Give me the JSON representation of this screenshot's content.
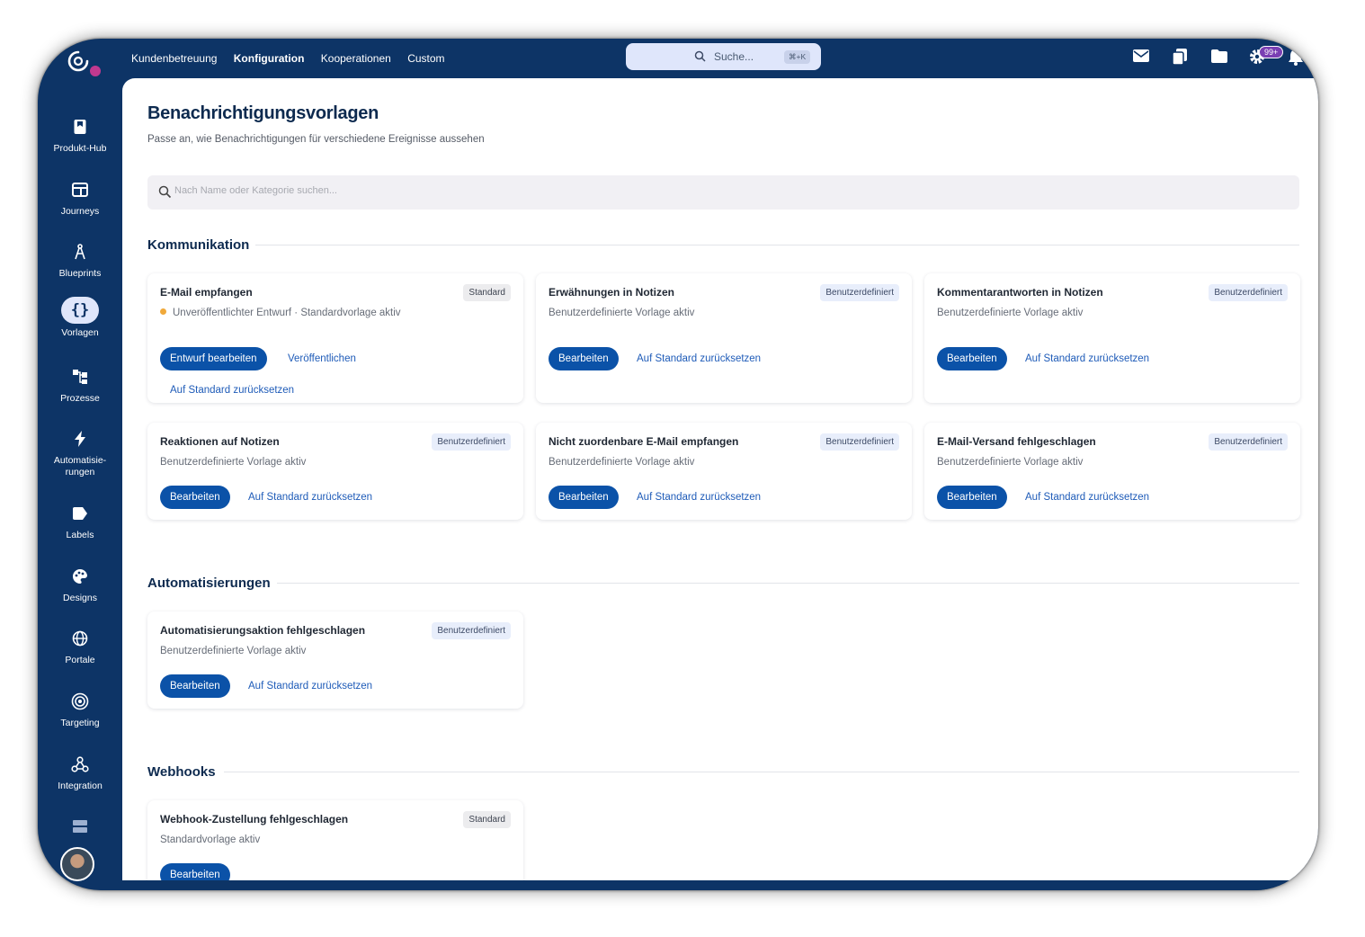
{
  "sidebar": {
    "items": [
      {
        "label": "Produkt-Hub",
        "icon": "bookmark-icon"
      },
      {
        "label": "Journeys",
        "icon": "layout-icon"
      },
      {
        "label": "Blueprints",
        "icon": "compass-icon"
      },
      {
        "label": "Vorlagen",
        "icon": "braces-icon",
        "active": true
      },
      {
        "label": "Prozesse",
        "icon": "workflow-icon"
      },
      {
        "label": "Automatisie-\nrungen",
        "icon": "bolt-icon"
      },
      {
        "label": "Labels",
        "icon": "tag-icon"
      },
      {
        "label": "Designs",
        "icon": "palette-icon"
      },
      {
        "label": "Portale",
        "icon": "globe-icon"
      },
      {
        "label": "Targeting",
        "icon": "target-icon"
      },
      {
        "label": "Integration",
        "icon": "webhook-icon"
      }
    ]
  },
  "topbar": {
    "nav": [
      "Kundenbetreuung",
      "Konfiguration",
      "Kooperationen",
      "Custom"
    ],
    "active_nav": "Konfiguration",
    "search_label": "Suche...",
    "search_shortcut": "⌘+K",
    "notification_count": "99+"
  },
  "page": {
    "title": "Benachrichtigungsvorlagen",
    "subtitle": "Passe an, wie Benachrichtigungen für verschiedene Ereignisse aussehen",
    "filter_placeholder": "Nach Name oder Kategorie suchen..."
  },
  "sections": {
    "kommunikation": "Kommunikation",
    "automatisierungen": "Automatisierungen",
    "webhooks": "Webhooks"
  },
  "cards": {
    "email_received": {
      "title": "E-Mail empfangen",
      "status": "Unveröffentlichter Entwurf · Standardvorlage aktiv",
      "tag": "Standard",
      "primary": "Entwurf bearbeiten",
      "link1": "Veröffentlichen",
      "link2": "Auf Standard zurücksetzen"
    },
    "mentions": {
      "title": "Erwähnungen in Notizen",
      "status": "Benutzerdefinierte Vorlage aktiv",
      "tag": "Benutzerdefiniert",
      "primary": "Bearbeiten",
      "link1": "Auf Standard zurücksetzen"
    },
    "comment_replies": {
      "title": "Kommentarantworten in Notizen",
      "status": "Benutzerdefinierte Vorlage aktiv",
      "tag": "Benutzerdefiniert",
      "primary": "Bearbeiten",
      "link1": "Auf Standard zurücksetzen"
    },
    "reactions": {
      "title": "Reaktionen auf Notizen",
      "status": "Benutzerdefinierte Vorlage aktiv",
      "tag": "Benutzerdefiniert",
      "primary": "Bearbeiten",
      "link1": "Auf Standard zurücksetzen"
    },
    "unassignable_email": {
      "title": "Nicht zuordenbare E-Mail empfangen",
      "status": "Benutzerdefinierte Vorlage aktiv",
      "tag": "Benutzerdefiniert",
      "primary": "Bearbeiten",
      "link1": "Auf Standard zurücksetzen"
    },
    "email_failed": {
      "title": "E-Mail-Versand fehlgeschlagen",
      "status": "Benutzerdefinierte Vorlage aktiv",
      "tag": "Benutzerdefiniert",
      "primary": "Bearbeiten",
      "link1": "Auf Standard zurücksetzen"
    },
    "automation_failed": {
      "title": "Automatisierungsaktion fehlgeschlagen",
      "status": "Benutzerdefinierte Vorlage aktiv",
      "tag": "Benutzerdefiniert",
      "primary": "Bearbeiten",
      "link1": "Auf Standard zurücksetzen"
    },
    "webhook_failed": {
      "title": "Webhook-Zustellung fehlgeschlagen",
      "status": "Standardvorlage aktiv",
      "tag": "Standard",
      "primary": "Bearbeiten"
    }
  }
}
